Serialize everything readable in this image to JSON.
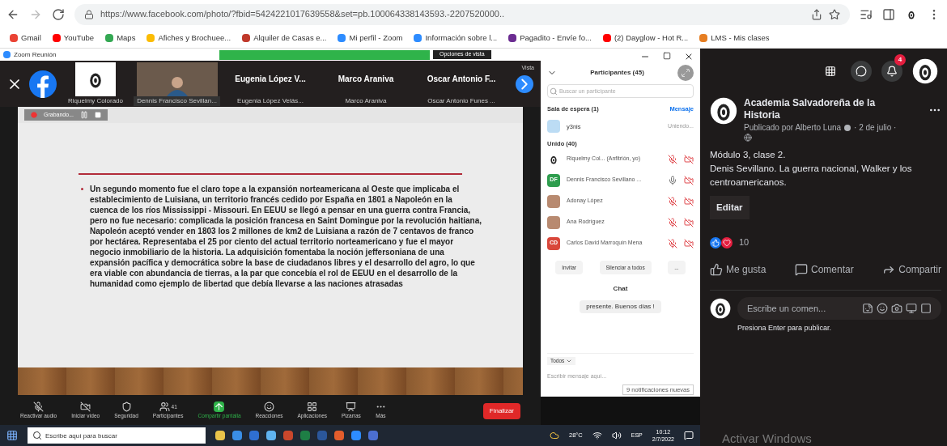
{
  "browser": {
    "url": "https://www.facebook.com/photo/?fbid=5424221017639558&set=pb.100064338143593.-2207520000..",
    "bookmarks": [
      {
        "label": "Gmail",
        "color": "#ea4335"
      },
      {
        "label": "YouTube",
        "color": "#ff0000"
      },
      {
        "label": "Maps",
        "color": "#34a853"
      },
      {
        "label": "Afiches y Brochuee...",
        "color": "#fbbc04"
      },
      {
        "label": "Alquiler de Casas e...",
        "color": "#c0392b"
      },
      {
        "label": "Mi perfil - Zoom",
        "color": "#2d8cff"
      },
      {
        "label": "Información sobre l...",
        "color": "#2d8cff"
      },
      {
        "label": "Pagadito - Envíe fo...",
        "color": "#6b2c91"
      },
      {
        "label": "(2) Dayglow - Hot R...",
        "color": "#ff0000"
      },
      {
        "label": "LMS - Mis clases",
        "color": "#e67e22"
      }
    ]
  },
  "zoom": {
    "window_title": "Zoom Reunión",
    "view_options": "Opciones de vista",
    "view_label": "Vista",
    "tiles": [
      {
        "kind": "logo",
        "label": "Riquelmy Colorado"
      },
      {
        "kind": "video",
        "label": "Dennis Francisco Sevillan..."
      },
      {
        "kind": "name",
        "name": "Eugenia López V...",
        "label": "Eugenia López Velás..."
      },
      {
        "kind": "name",
        "name": "Marco Araniva",
        "label": "Marco Araniva"
      },
      {
        "kind": "name",
        "name": "Oscar Antonio F...",
        "label": "Oscar Antonio Funes ..."
      }
    ],
    "recording": "Grabando...",
    "slide_text": "Un segundo momento fue el claro tope a la expansión norteamericana al Oeste que implicaba el establecimiento de Luisiana, un territorio francés cedido por España en 1801 a Napoleón en la cuenca de los ríos Mississippi - Missouri. En EEUU se llegó a pensar en una guerra contra Francia, pero no fue necesario: complicada la posición francesa en Saint Domingue por la revolución haitiana, Napoleón aceptó vender en 1803 los 2 millones de km2 de Luisiana a razón de 7 centavos de franco por hectárea. Representaba el 25 por ciento del actual territorio norteamericano y fue el mayor negocio inmobiliario de la historia. La adquisición fomentaba la noción jeffersoniana de una expansión pacífica y democrática sobre la base de ciudadanos libres y el desarrollo del agro, lo que era viable con abundancia de tierras, a la par que concebía el rol de EEUU en el desarrollo de la humanidad como ejemplo de libertad que debía llevarse a las naciones atrasadas",
    "toolbar": [
      {
        "kind": "mic",
        "label": "Reactivar audio"
      },
      {
        "kind": "video",
        "label": "Iniciar vídeo"
      },
      {
        "kind": "shield",
        "label": "Seguridad"
      },
      {
        "kind": "people",
        "label": "Participantes",
        "count": "41"
      },
      {
        "kind": "share",
        "label": "Compartir pantalla"
      },
      {
        "kind": "smile",
        "label": "Reacciones"
      },
      {
        "kind": "apps",
        "label": "Aplicaciones"
      },
      {
        "kind": "board",
        "label": "Pizarras"
      },
      {
        "kind": "more",
        "label": "Más"
      }
    ],
    "end_button": "Finalizar",
    "participants": {
      "title": "Participantes (45)",
      "search_placeholder": "Buscar un participante",
      "waiting_title": "Sala de espera (1)",
      "message_link": "Mensaje",
      "waiting_name": "y3nis",
      "waiting_status": "Uniendo...",
      "joined_title": "Unido (40)",
      "people": [
        {
          "kind": "logo",
          "name": "Riquelmy Col... (Anfitrión, yo)",
          "muted": true
        },
        {
          "kind": "initials",
          "initials": "DF",
          "color": "#2e9d4e",
          "name": "Dennis Francisco Sevillano ...",
          "muted": false
        },
        {
          "kind": "photo",
          "name": "Adonay López",
          "muted": true
        },
        {
          "kind": "photo",
          "name": "Ana Rodríguez",
          "muted": true
        },
        {
          "kind": "initials",
          "initials": "CD",
          "color": "#d9473b",
          "name": "Carlos David Marroquín Mena",
          "muted": true
        }
      ],
      "buttons": [
        "Invitar",
        "Silenciar a todos",
        "..."
      ]
    },
    "chat": {
      "title": "Chat",
      "message": "presente. Buenos días !",
      "recipient": "Todos",
      "placeholder": "Escribir mensaje aquí...",
      "notifications": "9 notificaciones nuevas"
    }
  },
  "taskbar": {
    "search_placeholder": "Escribe aquí para buscar",
    "weather": "28°C",
    "language": "ESP",
    "time": "10:12",
    "date": "2/7/2022"
  },
  "facebook": {
    "notification_count": "4",
    "page_name": "Academia Salvadoreña de la Historia",
    "author": "Publicado por Alberto Luna",
    "date": "· 2 de julio ·",
    "lines": [
      "Módulo 3, clase 2.",
      "Denis Sevillano. La guerra nacional, Walker y los centroamericanos."
    ],
    "edit": "Editar",
    "reaction_count": "10",
    "actions": [
      {
        "kind": "like",
        "label": "Me gusta"
      },
      {
        "kind": "comment",
        "label": "Comentar"
      },
      {
        "kind": "share",
        "label": "Compartir"
      }
    ],
    "comment_placeholder": "Escribe un comen...",
    "comment_hint": "Presiona Enter para publicar."
  },
  "watermark": "Activar Windows"
}
